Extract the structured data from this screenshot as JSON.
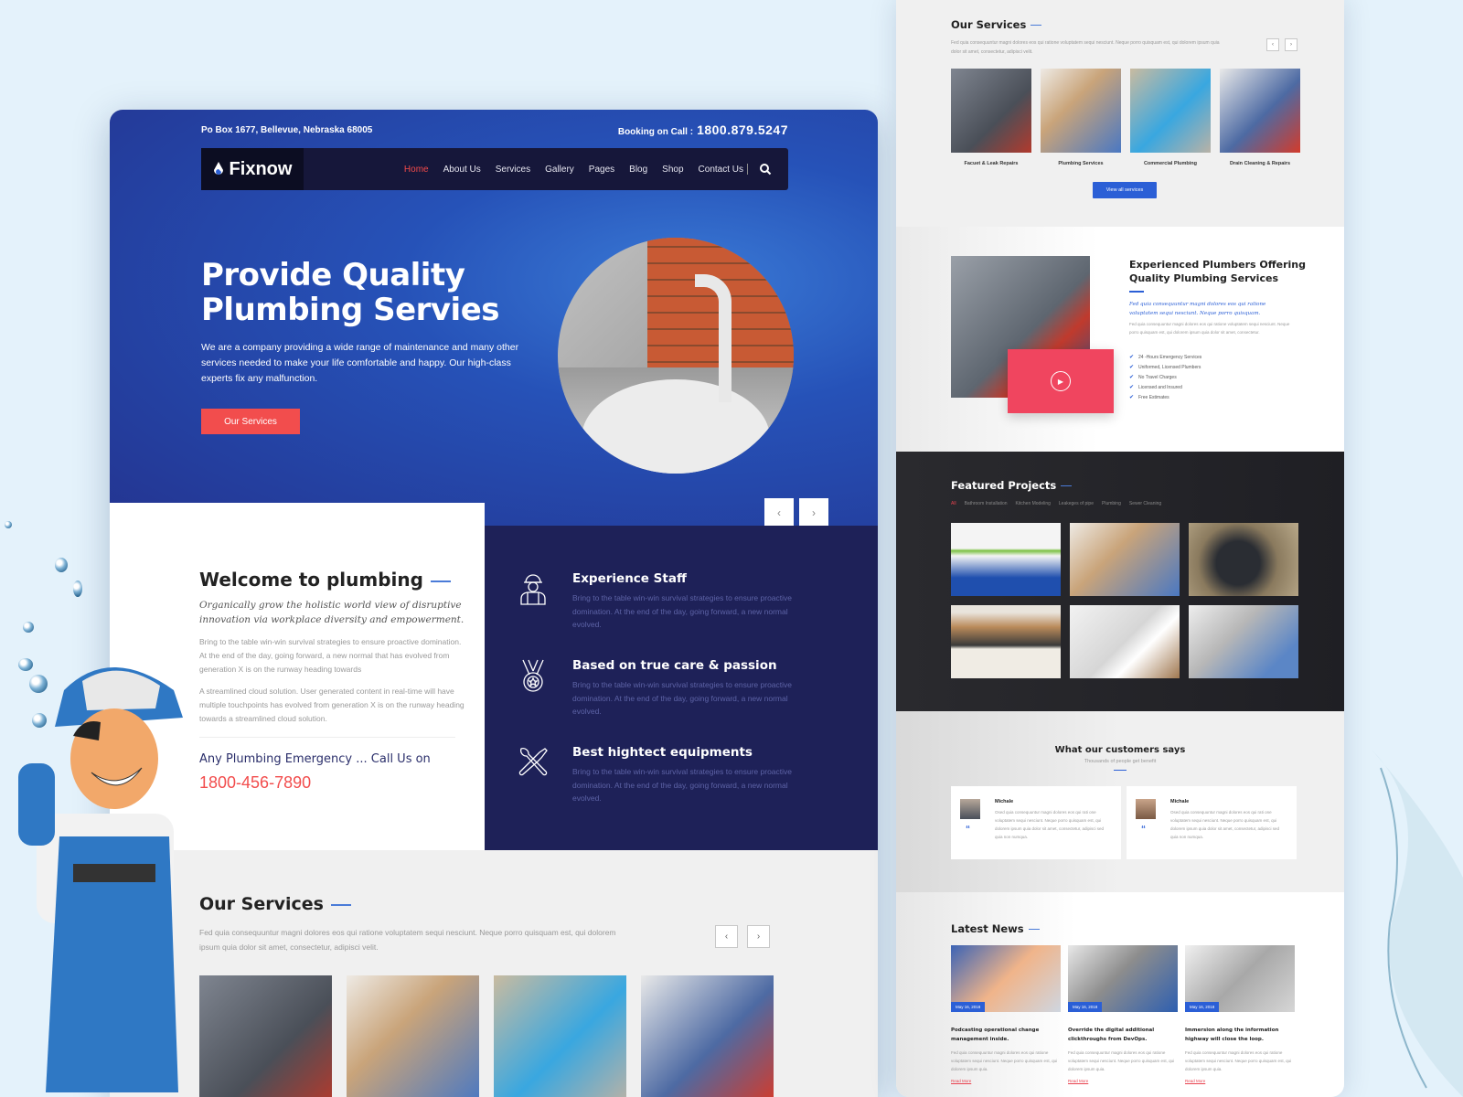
{
  "hero": {
    "address": "Po Box 1677, Bellevue, Nebraska 68005",
    "booking_label": "Booking on Call :",
    "booking_phone": "1800.879.5247",
    "logo": "Fixnow",
    "menu": [
      "Home",
      "About Us",
      "Services",
      "Gallery",
      "Pages",
      "Blog",
      "Shop",
      "Contact Us"
    ],
    "active_menu": "Home",
    "title_line1": "Provide Quality",
    "title_line2": "Plumbing Servies",
    "lead": "We are a company providing a wide range of maintenance and many other services needed to make your life comfortable and happy. Our high-class experts fix any malfunction.",
    "cta": "Our Services",
    "prev_icon": "‹",
    "next_icon": "›"
  },
  "welcome": {
    "title": "Welcome to plumbing",
    "italic": "Organically grow the holistic world view of disruptive innovation via workplace diversity and empowerment.",
    "para1": "Bring to the table win-win survival strategies to ensure proactive domination. At the end of the day, going forward, a new normal that has evolved from generation X is on the runway heading towards",
    "para2": "A streamlined cloud solution. User generated content in real-time will have multiple touchpoints has evolved from generation X is on the runway heading towards a streamlined cloud solution.",
    "emergency": "Any Plumbing Emergency ... Call Us on",
    "phone": "1800-456-7890"
  },
  "features": [
    {
      "icon": "worker-icon",
      "title": "Experience Staff",
      "text": "Bring to the table win-win survival strategies to ensure proactive domination. At the end of the day, going forward, a new normal evolved."
    },
    {
      "icon": "medal-icon",
      "title": "Based on true care & passion",
      "text": "Bring to the table win-win survival strategies to ensure proactive domination. At the end of the day, going forward, a new normal evolved."
    },
    {
      "icon": "tools-icon",
      "title": "Best hightect equipments",
      "text": "Bring to the table win-win survival strategies to ensure proactive domination. At the end of the day, going forward, a new normal evolved."
    }
  ],
  "services": {
    "title": "Our Services",
    "text": "Fed quia consequuntur magni dolores eos qui ratione voluptatem sequi nesciunt. Neque porro quisquam est, qui dolorem ipsum quia dolor sit amet, consectetur, adipisci velit.",
    "items": [
      "Facuet & Leak Repairs",
      "Plumbing Services",
      "Commercial Plumbing",
      "Drain Cleaning & Repairs"
    ],
    "view_all": "View all services"
  },
  "experienced": {
    "title": "Experienced Plumbers Offering Quality Plumbing Services",
    "italic": "Fed quia consequuntur magni dolores eos qui ratione voluptatem sequi nesciunt. Neque porro quisquam.",
    "text": "Fed quia consequuntur magni dolores eos qui ratione voluptatem sequi nesciunt. Neque porro quisquam est, qui dolorem ipsum quia dolor sit amet, consectetur.",
    "checklist": [
      "24 -Hours Emergency Services",
      "Uniformed, Licensed Plumbers",
      "No Travel Charges",
      "Licensed and Insured",
      "Free Estimates"
    ]
  },
  "projects": {
    "title": "Featured Projects",
    "tabs": [
      "All",
      "Bathroom Installation",
      "Kitchen Modeling",
      "Leakeges of pipe",
      "Plumbing",
      "Sewer Cleaning"
    ],
    "active_tab": "All"
  },
  "testimonials": {
    "title": "What our customers says",
    "subtitle": "Thousands of people get benefit",
    "items": [
      {
        "name": "Michale",
        "text": "Osed quia consequuntur magni dolores eos qui rati one voluptatem sequi nesciunt. Neque porro quisquam est, qui dolorem ipsum quia dolor sit amet, consectetur, adipisci sed quia non numqua."
      },
      {
        "name": "Michale",
        "text": "Osed quia consequuntur magni dolores eos qui rati one voluptatem sequi nesciunt. Neque porro quisquam est, qui dolorem ipsum quia dolor sit amet, consectetur, adipisci sed quia non numqua."
      }
    ]
  },
  "news": {
    "title": "Latest News",
    "items": [
      {
        "date": "May 16, 2018",
        "title": "Podcasting operational change management inside.",
        "text": "Fed quia consequuntur magni dolores eos qui ratione voluptatem sequi nesciunt. Neque porro quisquam est, qui dolorem ipsum quia.",
        "link": "Read More"
      },
      {
        "date": "May 16, 2018",
        "title": "Override the digital additional clickthroughs from DevOps.",
        "text": "Fed quia consequuntur magni dolores eos qui ratione voluptatem sequi nesciunt. Neque porro quisquam est, qui dolorem ipsum quia.",
        "link": "Read More"
      },
      {
        "date": "May 16, 2018",
        "title": "Immersion along the information highway will close the loop.",
        "text": "Fed quia consequuntur magni dolores eos qui ratione voluptatem sequi nesciunt. Neque porro quisquam est, qui dolorem ipsum quia.",
        "link": "Read More"
      }
    ]
  },
  "colors": {
    "brand_blue": "#2b5fd6",
    "accent_red": "#f24d4d",
    "navy": "#1e2158"
  }
}
